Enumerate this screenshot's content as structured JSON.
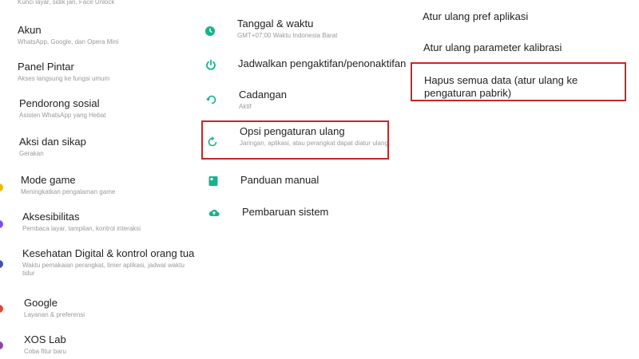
{
  "column1": {
    "top_fragment": "Kunci layar, sidik jari, Face Unlock",
    "items": [
      {
        "title": "Akun",
        "sub": "WhatsApp, Google, dan Opera Mini"
      },
      {
        "title": "Panel Pintar",
        "sub": "Akses langsung ke fungsi umum"
      },
      {
        "title": "Pendorong sosial",
        "sub": "Asisten WhatsApp yang Hebat"
      },
      {
        "title": "Aksi dan sikap",
        "sub": "Gerakan"
      },
      {
        "title": "Mode game",
        "sub": "Meningkatkan pengalaman game"
      },
      {
        "title": "Aksesibilitas",
        "sub": "Pembaca layar, tampilan, kontrol interaksi"
      },
      {
        "title": "Kesehatan Digital & kontrol orang tua",
        "sub": "Waktu pemakaian perangkat, timer aplikasi, jadwal waktu tidur"
      },
      {
        "title": "Google",
        "sub": "Layanan & preferensi"
      },
      {
        "title": "XOS Lab",
        "sub": "Coba fitur baru"
      }
    ]
  },
  "column2": {
    "items": [
      {
        "title": "Tanggal & waktu",
        "sub": "GMT+07:00 Waktu Indonesia Barat",
        "icon": "clock-icon"
      },
      {
        "title": "Jadwalkan pengaktifan/penonaktifan",
        "sub": "",
        "icon": "power-icon"
      },
      {
        "title": "Cadangan",
        "sub": "Aktif",
        "icon": "backup-icon"
      },
      {
        "title": "Opsi pengaturan ulang",
        "sub": "Jaringan, aplikasi, atau perangkat dapat diatur ulang",
        "icon": "reset-icon"
      },
      {
        "title": "Panduan manual",
        "sub": "",
        "icon": "manual-icon"
      },
      {
        "title": "Pembaruan sistem",
        "sub": "",
        "icon": "cloud-update-icon"
      }
    ]
  },
  "column3": {
    "items": [
      {
        "title": "Atur ulang pref aplikasi"
      },
      {
        "title": "Atur ulang parameter kalibrasi"
      },
      {
        "title": "Hapus semua data (atur ulang ke pengaturan pabrik)"
      }
    ]
  },
  "colors": {
    "accent": "#16b28c",
    "highlight": "#c62828",
    "subtext": "#9a9a9a"
  }
}
